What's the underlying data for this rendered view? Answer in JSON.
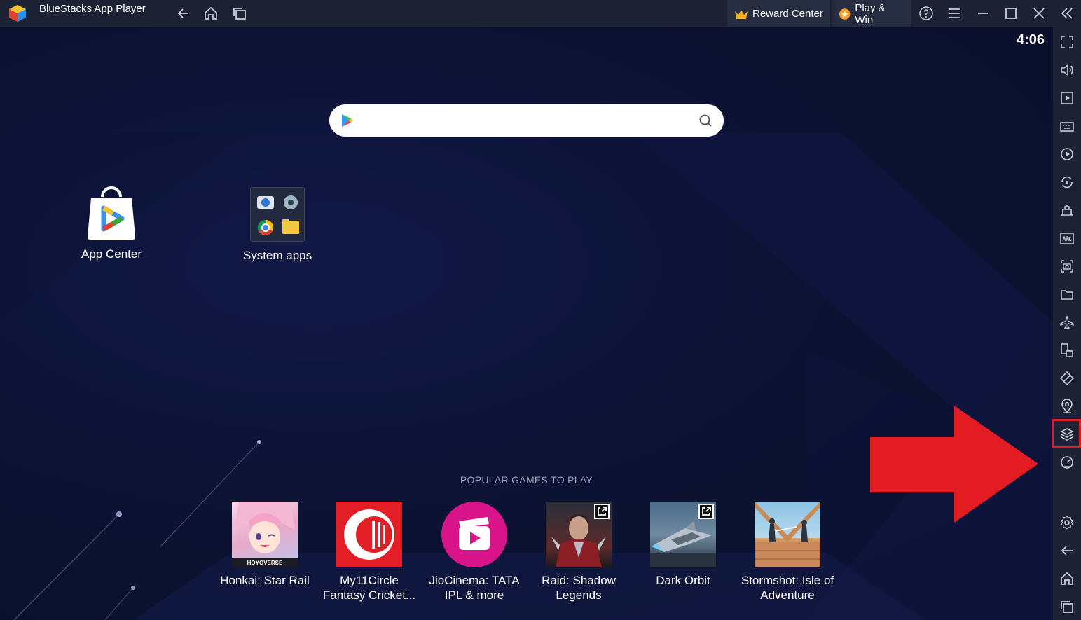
{
  "titlebar": {
    "app_title": "BlueStacks App Player",
    "reward_center": "Reward Center",
    "play_win": "Play & Win"
  },
  "screen": {
    "clock": "4:06",
    "desktop_apps": [
      {
        "label": "App Center"
      },
      {
        "label": "System apps"
      }
    ],
    "popular_title": "POPULAR GAMES TO PLAY",
    "games": [
      {
        "title": "Honkai: Star Rail"
      },
      {
        "title": "My11Circle Fantasy Cricket..."
      },
      {
        "title": "JioCinema: TATA IPL & more"
      },
      {
        "title": "Raid: Shadow Legends"
      },
      {
        "title": "Dark Orbit"
      },
      {
        "title": "Stormshot: Isle of Adventure"
      }
    ],
    "thumb_texts": {
      "hoyoverse": "HOYOVERSE"
    }
  },
  "sidebar": {
    "icons": [
      "fullscreen-icon",
      "volume-icon",
      "media-manager-icon",
      "keyboard-icon",
      "macro-icon",
      "rotate-icon",
      "build-icon",
      "apk-icon",
      "screenshot-icon",
      "folder-icon",
      "airplane-icon",
      "multi-instance-icon",
      "eco-mode-icon",
      "location-icon",
      "layers-icon",
      "performance-icon",
      "settings-icon",
      "back-icon",
      "home-icon",
      "recents-icon"
    ]
  },
  "colors": {
    "titlebar_bg": "#1d2334",
    "screen_bg": "#0c1231",
    "highlight": "#e31b23",
    "accent_arrow": "#e31b23"
  }
}
